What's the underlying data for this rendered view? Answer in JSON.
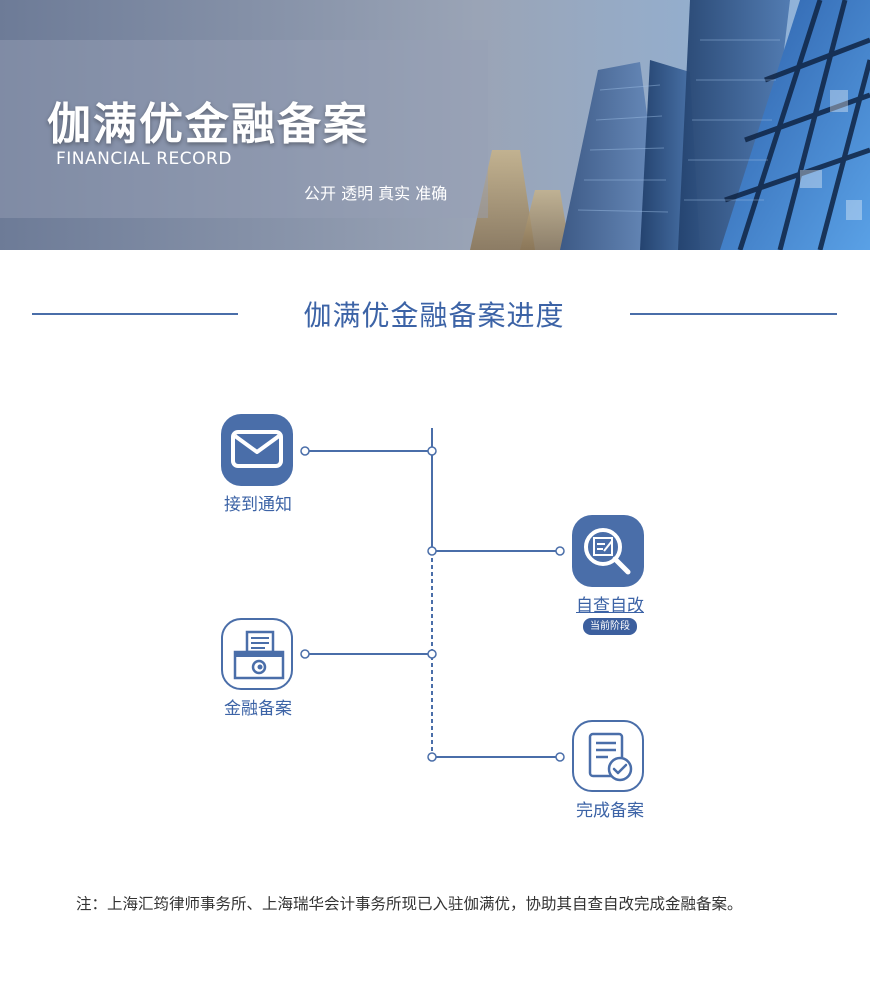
{
  "banner": {
    "title": "伽满优金融备案",
    "subtitle": "FINANCIAL RECORD",
    "tagline": "公开 透明 真实 准确"
  },
  "section": {
    "title": "伽满优金融备案进度"
  },
  "steps": [
    {
      "label": "接到通知",
      "icon": "envelope-icon",
      "state": "done"
    },
    {
      "label": "自查自改",
      "icon": "magnifier-document-icon",
      "state": "current",
      "badge": "当前阶段"
    },
    {
      "label": "金融备案",
      "icon": "printer-icon",
      "state": "pending"
    },
    {
      "label": "完成备案",
      "icon": "document-check-icon",
      "state": "pending"
    }
  ],
  "note": "注：上海汇筠律师事务所、上海瑞华会计事务所现已入驻伽满优，协助其自查自改完成金融备案。",
  "colors": {
    "accent": "#4a6ea9",
    "heading": "#3c63a6",
    "badge": "#3c5f9e"
  }
}
